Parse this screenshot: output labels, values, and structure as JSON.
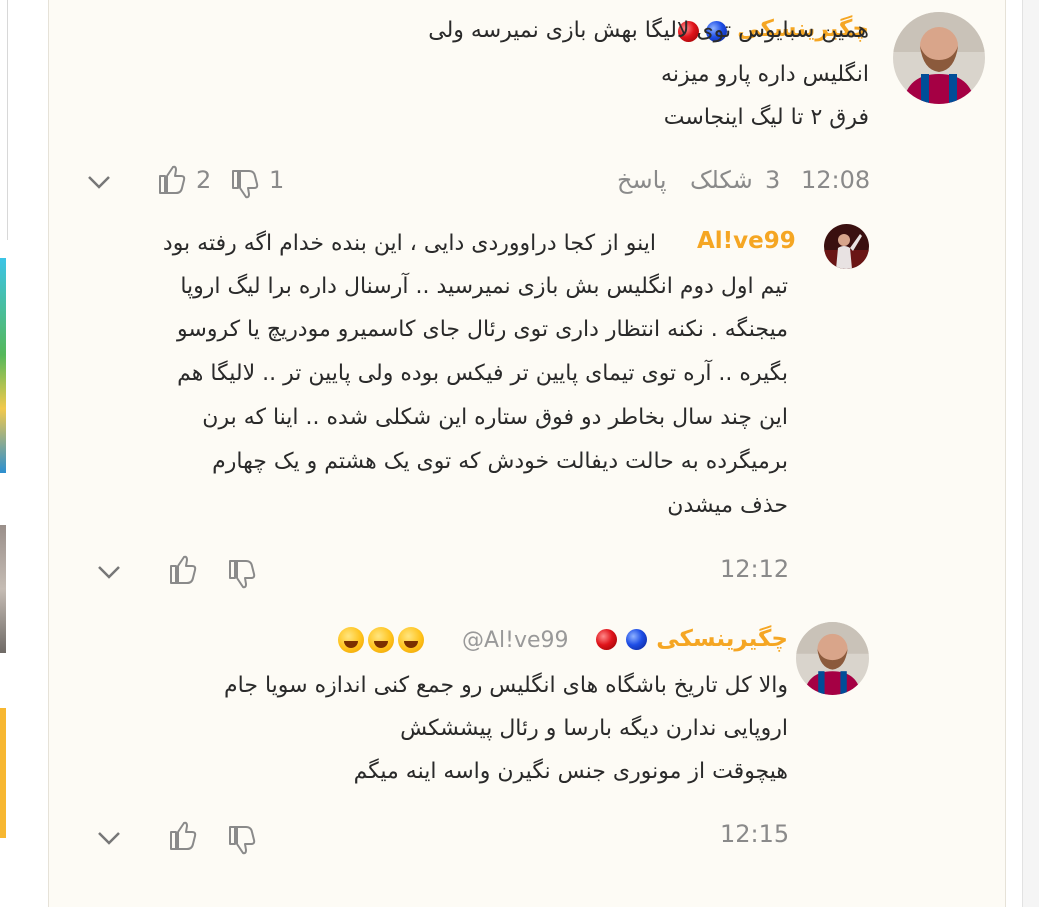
{
  "colors": {
    "username": "#f5a623",
    "panel_bg": "#fdfbf5",
    "meta_gray": "#8a8a8a"
  },
  "comments": [
    {
      "username": "چگیرینسکی",
      "lines": [
        "همین سبایوس توی لالیگا بهش بازی نمیرسه ولی",
        "انگلیس داره پارو میزنه",
        "فرق ۲ تا لیگ اینجاست"
      ],
      "time": "12:08",
      "meta_count": "3",
      "meta_label": "شکلک",
      "reply_label": "پاسخ",
      "likes": "2",
      "dislikes": "1"
    },
    {
      "username": "Al!ve99",
      "lines": [
        "اینو از کجا دراووردی دایی ، این بنده خدام اگه رفته بود",
        "تیم اول دوم انگلیس بش بازی نمیرسید .. آرسنال داره برا لیگ اروپا",
        "میجنگه . نکنه انتظار داری توی رئال جای کاسمیرو مودریچ یا کروسو",
        "بگیره .. آره توی تیمای پایین تر فیکس بوده ولی پایین تر .. لالیگا هم",
        "این چند سال بخاطر دو فوق ستاره این شکلی شده .. اینا که برن",
        "برمیگرده به حالت دیفالت خودش که توی یک هشتم و یک چهارم",
        "حذف میشدن"
      ],
      "time": "12:12"
    },
    {
      "username": "چگیرینسکی",
      "mention": "@Al!ve99",
      "lines": [
        "والا کل تاریخ باشگاه های انگلیس رو جمع کنی اندازه سویا جام",
        "اروپایی ندارن دیگه بارسا و رئال پیششکش",
        "هیچوقت از مونوری جنس نگیرن واسه اینه میگم"
      ],
      "time": "12:15"
    }
  ],
  "icons": [
    "thumbs-up-icon",
    "thumbs-down-icon",
    "chevron-down-icon",
    "joy-emoji-icon"
  ]
}
